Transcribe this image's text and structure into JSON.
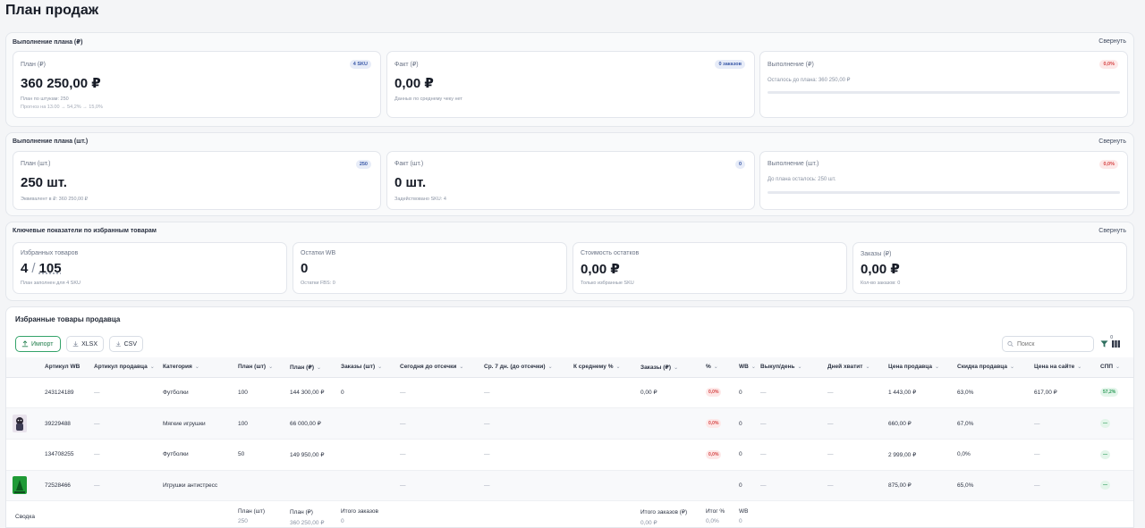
{
  "page": {
    "title": "План продаж"
  },
  "sections": {
    "rub": {
      "title": "Выполнение плана (₽)",
      "collapse": "Свернуть",
      "plan": {
        "label": "План (₽)",
        "badge": "4 SKU",
        "value": "360 250,00 ₽",
        "sub1": "План по штукам: 250",
        "sub2": "Прогноз на 13.00 → 54,2% → 15,0%"
      },
      "fact": {
        "label": "Факт (₽)",
        "badge": "0 заказов",
        "value": "0,00 ₽",
        "sub1": "Данных по среднему чеку нет"
      },
      "done": {
        "label": "Выполнение (₽)",
        "badge": "0,0%",
        "sub1": "Осталось до плана: 360 250,00 ₽",
        "progress": 0
      }
    },
    "pcs": {
      "title": "Выполнение плана (шт.)",
      "collapse": "Свернуть",
      "plan": {
        "label": "План (шт.)",
        "badge": "250",
        "value": "250 шт.",
        "sub1": "Эквивалент в ₽: 360 250,00 ₽"
      },
      "fact": {
        "label": "Факт (шт.)",
        "badge": "0",
        "value": "0 шт.",
        "sub1": "Задействовано SKU: 4"
      },
      "done": {
        "label": "Выполнение (шт.)",
        "badge": "0,0%",
        "sub1": "До плана осталось: 250 шт.",
        "progress": 0
      }
    },
    "kpi": {
      "title": "Ключевые показатели по избранным товарам",
      "collapse": "Свернуть",
      "fav": {
        "label": "Избранных товаров",
        "count": "4",
        "sep": "/",
        "total": "105",
        "sub": "План заполнен для 4 SKU"
      },
      "stock": {
        "label": "Остатки WB",
        "value": "0",
        "sub": "Остатки FBS: 0"
      },
      "stock_cost": {
        "label": "Стоимость остатков",
        "value": "0,00 ₽",
        "sub": "Только избранные SKU"
      },
      "orders": {
        "label": "Заказы (₽)",
        "value": "0,00 ₽",
        "sub": "Кол-во заказов: 0"
      }
    }
  },
  "table": {
    "title": "Избранные товары продавца",
    "toolbar": {
      "import": "Импорт",
      "xlsx": "XLSX",
      "csv": "CSV",
      "search_placeholder": "Поиск",
      "filter_count": "0"
    },
    "columns": [
      "Артикул WB",
      "Артикул продавца",
      "Категория",
      "План (шт)",
      "План (₽)",
      "Заказы (шт)",
      "Сегодня до отсечки",
      "Ср. 7 дн. (до отсечки)",
      "К среднему %",
      "Заказы (₽)",
      "%",
      "WB",
      "Выкуп/день",
      "Дней хватит",
      "Цена продавца",
      "Скидка продавца",
      "Цена на сайте",
      "СПП"
    ],
    "rows": [
      {
        "thumb": "none",
        "cells": [
          "243124189",
          "—",
          "Футболки",
          "100",
          "144 300,00 ₽",
          "0",
          "—",
          "—",
          "",
          "0,00 ₽",
          "0,0%",
          "0",
          "—",
          "—",
          "1 443,00 ₽",
          "63,0%",
          "617,00 ₽",
          "57,2%"
        ]
      },
      {
        "thumb": "toy",
        "cells": [
          "39229488",
          "—",
          "Мягкие игрушки",
          "100",
          "66 000,00 ₽",
          "",
          "—",
          "—",
          "",
          "",
          "0,0%",
          "0",
          "—",
          "—",
          "660,00 ₽",
          "67,0%",
          "—",
          "—"
        ]
      },
      {
        "thumb": "blank",
        "cells": [
          "134708255",
          "—",
          "Футболки",
          "50",
          "149 950,00 ₽",
          "",
          "—",
          "—",
          "",
          "",
          "0,0%",
          "0",
          "—",
          "—",
          "2 999,00 ₽",
          "0,0%",
          "—",
          "—"
        ]
      },
      {
        "thumb": "green",
        "cells": [
          "72528466",
          "—",
          "Игрушки антистресс",
          "",
          "",
          "",
          "—",
          "—",
          "",
          "",
          "",
          "0",
          "—",
          "—",
          "875,00 ₽",
          "65,0%",
          "—",
          "—"
        ]
      }
    ],
    "summary": {
      "label": "Сводка",
      "plan_pcs_label": "План (шт)",
      "plan_pcs": "250",
      "plan_rub_label": "План (₽)",
      "plan_rub": "360 250,00 ₽",
      "orders_label": "Итого заказов",
      "orders": "0",
      "orders_rub_label": "Итого заказов (₽)",
      "orders_rub": "0,00 ₽",
      "pct_label": "Итог %",
      "pct": "0,0%",
      "wb_label": "WB",
      "wb": "0"
    }
  },
  "colors": {
    "accent": "#3b82f6",
    "danger": "#d64545",
    "success": "#2b9a57",
    "import_border": "#34a36a"
  }
}
